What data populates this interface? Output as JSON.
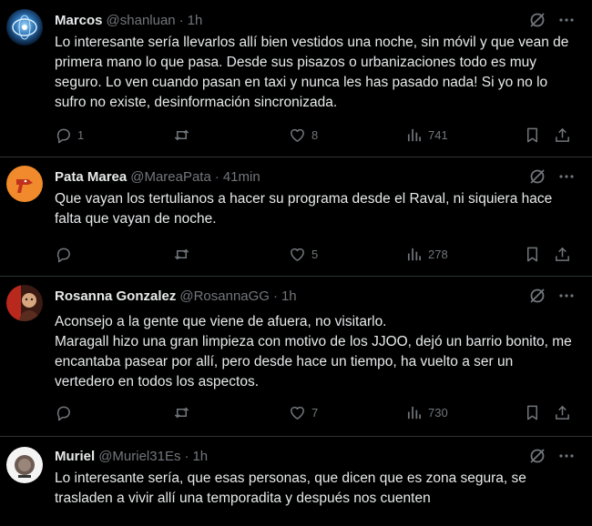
{
  "tweets": [
    {
      "name": "Marcos",
      "handle": "@shanluan",
      "dot": "·",
      "time": "1h",
      "text": "Lo interesante sería llevarlos allí bien vestidos una noche, sin móvil y que vean de primera mano lo que pasa. Desde sus pisazos o urbanizaciones todo es muy seguro. Lo ven cuando pasan en taxi y nunca les has pasado nada! Si yo no lo sufro no existe, desinformación sincronizada.",
      "replies": "1",
      "reposts": "",
      "likes": "8",
      "views": "741",
      "avatar_icon": "globe-avatar"
    },
    {
      "name": "Pata Marea",
      "handle": "@MareaPata",
      "dot": "·",
      "time": "41min",
      "text": "Que vayan los tertulianos a hacer su programa desde el Raval, ni siquiera hace falta que vayan de noche.",
      "replies": "",
      "reposts": "",
      "likes": "5",
      "views": "278",
      "avatar_icon": "duck-logo-avatar"
    },
    {
      "name": "Rosanna Gonzalez",
      "handle": "@RosannaGG",
      "dot": "·",
      "time": "1h",
      "text": "Aconsejo a la gente que viene de afuera, no visitarlo.\nMaragall hizo una gran limpieza con motivo de los JJOO, dejó un barrio bonito, me encantaba pasear por allí, pero desde hace un tiempo, ha vuelto a ser un vertedero en todos los aspectos.",
      "replies": "",
      "reposts": "",
      "likes": "7",
      "views": "730",
      "avatar_icon": "portrait-avatar"
    },
    {
      "name": "Muriel",
      "handle": "@Muriel31Es",
      "dot": "·",
      "time": "1h",
      "text": "Lo interesante sería, que esas personas, que dicen que es zona segura, se trasladen a vivir allí una temporadita y después nos cuenten",
      "avatar_icon": "badge-avatar"
    }
  ],
  "colors": {
    "background": "#000000",
    "text": "#e7e9ea",
    "muted": "#71767b",
    "divider": "#2f3336"
  }
}
